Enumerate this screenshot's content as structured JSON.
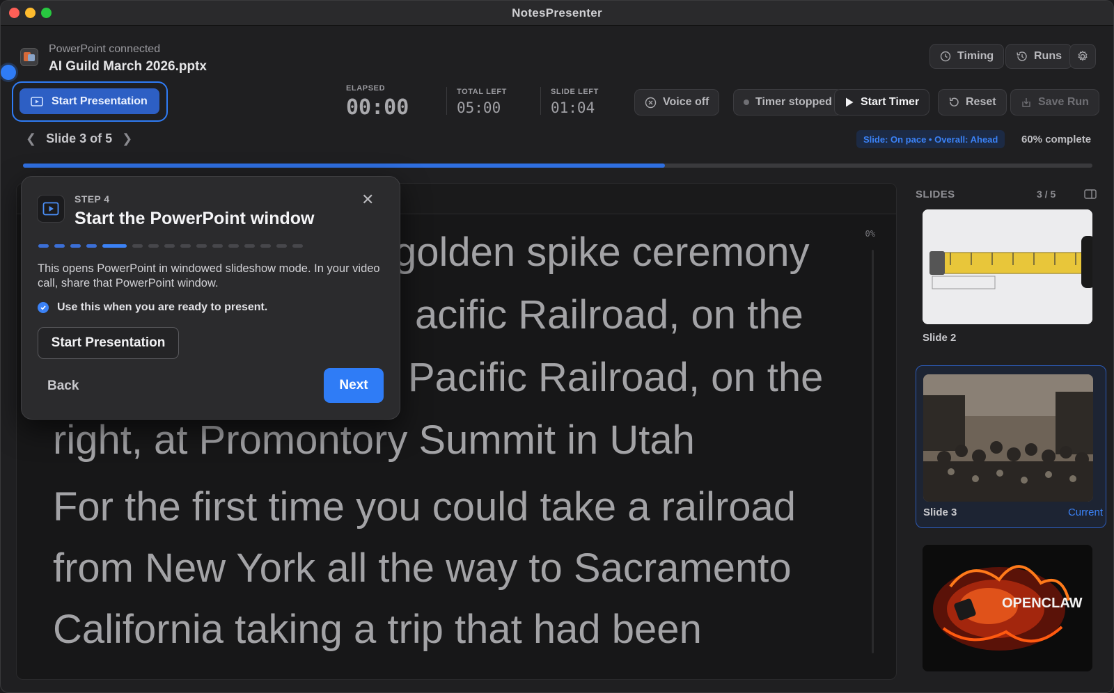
{
  "window": {
    "title": "NotesPresenter"
  },
  "header": {
    "connection_status": "PowerPoint connected",
    "file_name": "AI Guild March 2026.pptx",
    "start_presentation_label": "Start Presentation",
    "timing_label": "Timing",
    "runs_label": "Runs",
    "voice_label": "Voice off",
    "timer_status_label": "Timer stopped",
    "start_timer_label": "Start Timer",
    "reset_label": "Reset",
    "save_run_label": "Save Run"
  },
  "stats": {
    "elapsed_label": "ELAPSED",
    "elapsed_value": "00:00",
    "total_left_label": "TOTAL LEFT",
    "total_left_value": "05:00",
    "slide_left_label": "SLIDE LEFT",
    "slide_left_value": "01:04"
  },
  "navigation": {
    "slide_position": "Slide 3 of 5",
    "pace_status": "Slide: On pace • Overall: Ahead",
    "percent_complete_label": "60% complete",
    "progress_fraction": 0.6
  },
  "notes": {
    "scroll_percent": "0%",
    "paragraphs": [
      "golden spike ceremony",
      "acific Railroad, on the",
      "Pacific Railroad, on the",
      "right, at Promontory Summit in Utah",
      "For the first time you could take a railroad from New York all the way to Sacramento California taking a trip that had been"
    ]
  },
  "sidebar": {
    "title": "SLIDES",
    "count": "3 / 5",
    "thumbnails": [
      {
        "label": "Slide 2",
        "current": false
      },
      {
        "label": "Slide 3",
        "current": true,
        "current_label": "Current"
      },
      {
        "label": "",
        "current": false,
        "logo_text": "OPENCLAW"
      }
    ]
  },
  "popover": {
    "step": "STEP 4",
    "title": "Start the PowerPoint window",
    "description": "This opens PowerPoint in windowed slideshow mode. In your video call, share that PowerPoint window.",
    "check_text": "Use this when you are ready to present.",
    "start_button": "Start Presentation",
    "back_button": "Back",
    "next_button": "Next",
    "total_steps": 16,
    "current_step": 5
  },
  "colors": {
    "accent": "#2f7cf6",
    "background": "#1f1f21",
    "notes_text": "#a3a3a6"
  }
}
